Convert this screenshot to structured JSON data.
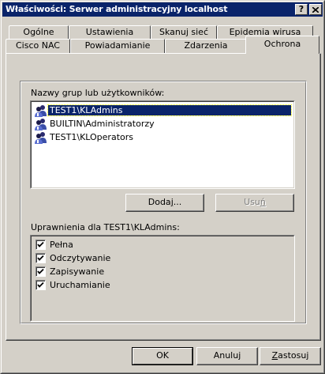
{
  "window": {
    "title": "Właściwości: Serwer administracyjny localhost",
    "help_label": "?",
    "close_label": "✕"
  },
  "tabs": {
    "row1": [
      "Ogólne",
      "Ustawienia",
      "Skanuj sieć",
      "Epidemia wirusa"
    ],
    "row2": [
      "Cisco NAC",
      "Powiadamianie",
      "Zdarzenia",
      "Ochrona"
    ],
    "active": "Ochrona"
  },
  "groups": {
    "label": "Nazwy grup lub użytkowników:",
    "items": [
      {
        "name": "TEST1\\KLAdmins",
        "icon": "user-group-icon",
        "selected": true
      },
      {
        "name": "BUILTIN\\Administratorzy",
        "icon": "user-group-icon",
        "selected": false
      },
      {
        "name": "TEST1\\KLOperators",
        "icon": "user-group-icon",
        "selected": false
      }
    ],
    "add_button": {
      "pre": "Doda",
      "accel": "j",
      "post": "..."
    },
    "remove_button": {
      "pre": "Usu",
      "accel": "ń",
      "post": ""
    }
  },
  "permissions": {
    "label": "Uprawnienia dla TEST1\\KLAdmins:",
    "items": [
      {
        "label": "Pełna",
        "checked": true
      },
      {
        "label": "Odczytywanie",
        "checked": true
      },
      {
        "label": "Zapisywanie",
        "checked": true
      },
      {
        "label": "Uruchamianie",
        "checked": true
      }
    ]
  },
  "footer": {
    "ok_label": "OK",
    "cancel_label": "Anuluj",
    "apply": {
      "pre": "",
      "accel": "Z",
      "post": "astosuj"
    }
  },
  "colors": {
    "titlebar": "#0a246a",
    "face": "#d4d0c8",
    "selection": "#0a246a"
  }
}
